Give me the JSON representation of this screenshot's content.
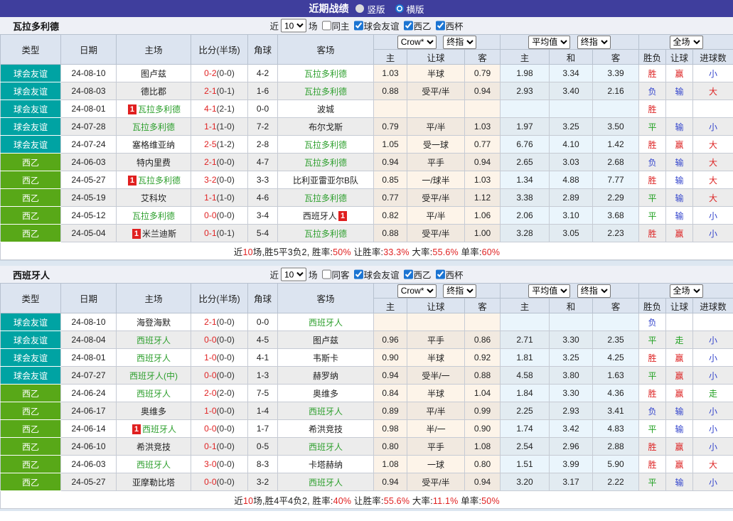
{
  "colors": {
    "titlebar_bg": "#3f3e9d",
    "type_friendly": "#00a3a3",
    "type_league": "#58a818",
    "team_green": "#2fa02f",
    "score_red": "#e02222",
    "red": "#dd2222",
    "blue": "#3344cc",
    "green": "#1fa01f",
    "badge_bg": "#e02020",
    "accent_blue": "#1b74d2"
  },
  "titlebar": {
    "title": "近期战绩",
    "radios": [
      {
        "label": "竖版",
        "selected": false
      },
      {
        "label": "横版",
        "selected": true
      }
    ]
  },
  "controls": {
    "near": "近",
    "games": "场",
    "count": "10",
    "book": "Crow*",
    "final": "终指",
    "average": "平均值",
    "scope": "全场"
  },
  "header": {
    "cols": [
      "类型",
      "日期",
      "主场",
      "比分(半场)",
      "角球",
      "客场"
    ],
    "subcols": [
      "主",
      "让球",
      "客",
      "主",
      "和",
      "客",
      "胜负",
      "让球",
      "进球数"
    ]
  },
  "tables": [
    {
      "team": "瓦拉多利德",
      "filter": {
        "same_label": "同主",
        "same_checked": false,
        "comps": [
          {
            "label": "球会友谊",
            "checked": true
          },
          {
            "label": "西乙",
            "checked": true
          },
          {
            "label": "西杯",
            "checked": true
          }
        ]
      },
      "rows": [
        {
          "type": "球会友谊",
          "type_key": "friendly",
          "date": "24-08-10",
          "home": {
            "name": "图卢兹",
            "green": false
          },
          "ft": "0-2",
          "ht": "(0-0)",
          "corner": "4-2",
          "away": {
            "name": "瓦拉多利德",
            "green": true
          },
          "odds": [
            "1.03",
            "半球",
            "0.79",
            "1.98",
            "3.34",
            "3.39"
          ],
          "results": [
            {
              "t": "胜",
              "c": "red"
            },
            {
              "t": "赢",
              "c": "red"
            },
            {
              "t": "小",
              "c": "blue"
            }
          ]
        },
        {
          "type": "球会友谊",
          "type_key": "friendly",
          "date": "24-08-03",
          "home": {
            "name": "德比郡",
            "green": false
          },
          "ft": "2-1",
          "ht": "(0-1)",
          "corner": "1-6",
          "away": {
            "name": "瓦拉多利德",
            "green": true
          },
          "odds": [
            "0.88",
            "受平/半",
            "0.94",
            "2.93",
            "3.40",
            "2.16"
          ],
          "results": [
            {
              "t": "负",
              "c": "blue"
            },
            {
              "t": "输",
              "c": "blue"
            },
            {
              "t": "大",
              "c": "red"
            }
          ]
        },
        {
          "type": "球会友谊",
          "type_key": "friendly",
          "date": "24-08-01",
          "home": {
            "name": "瓦拉多利德",
            "green": true,
            "badge": "1",
            "badge_pos": "pre"
          },
          "ft": "4-1",
          "ht": "(2-1)",
          "corner": "0-0",
          "away": {
            "name": "波城",
            "green": false
          },
          "odds": [
            "",
            "",
            "",
            "",
            "",
            ""
          ],
          "results": [
            {
              "t": "胜",
              "c": "red"
            },
            {
              "t": "",
              "c": ""
            },
            {
              "t": "",
              "c": ""
            }
          ]
        },
        {
          "type": "球会友谊",
          "type_key": "friendly",
          "date": "24-07-28",
          "home": {
            "name": "瓦拉多利德",
            "green": true
          },
          "ft": "1-1",
          "ht": "(1-0)",
          "corner": "7-2",
          "away": {
            "name": "布尔戈斯",
            "green": false
          },
          "odds": [
            "0.79",
            "平/半",
            "1.03",
            "1.97",
            "3.25",
            "3.50"
          ],
          "results": [
            {
              "t": "平",
              "c": "green"
            },
            {
              "t": "输",
              "c": "blue"
            },
            {
              "t": "小",
              "c": "blue"
            }
          ]
        },
        {
          "type": "球会友谊",
          "type_key": "friendly",
          "date": "24-07-24",
          "home": {
            "name": "塞格维亚纳",
            "green": false
          },
          "ft": "2-5",
          "ht": "(1-2)",
          "corner": "2-8",
          "away": {
            "name": "瓦拉多利德",
            "green": true
          },
          "odds": [
            "1.05",
            "受一球",
            "0.77",
            "6.76",
            "4.10",
            "1.42"
          ],
          "results": [
            {
              "t": "胜",
              "c": "red"
            },
            {
              "t": "赢",
              "c": "red"
            },
            {
              "t": "大",
              "c": "red"
            }
          ]
        },
        {
          "type": "西乙",
          "type_key": "league",
          "date": "24-06-03",
          "home": {
            "name": "特内里费",
            "green": false
          },
          "ft": "2-1",
          "ht": "(0-0)",
          "corner": "4-7",
          "away": {
            "name": "瓦拉多利德",
            "green": true
          },
          "odds": [
            "0.94",
            "平手",
            "0.94",
            "2.65",
            "3.03",
            "2.68"
          ],
          "results": [
            {
              "t": "负",
              "c": "blue"
            },
            {
              "t": "输",
              "c": "blue"
            },
            {
              "t": "大",
              "c": "red"
            }
          ]
        },
        {
          "type": "西乙",
          "type_key": "league",
          "date": "24-05-27",
          "home": {
            "name": "瓦拉多利德",
            "green": true,
            "badge": "1",
            "badge_pos": "pre"
          },
          "ft": "3-2",
          "ht": "(0-0)",
          "corner": "3-3",
          "away": {
            "name": "比利亚雷亚尔B队",
            "green": false
          },
          "odds": [
            "0.85",
            "一/球半",
            "1.03",
            "1.34",
            "4.88",
            "7.77"
          ],
          "results": [
            {
              "t": "胜",
              "c": "red"
            },
            {
              "t": "输",
              "c": "blue"
            },
            {
              "t": "大",
              "c": "red"
            }
          ]
        },
        {
          "type": "西乙",
          "type_key": "league",
          "date": "24-05-19",
          "home": {
            "name": "艾科坎",
            "green": false
          },
          "ft": "1-1",
          "ht": "(1-0)",
          "corner": "4-6",
          "away": {
            "name": "瓦拉多利德",
            "green": true
          },
          "odds": [
            "0.77",
            "受平/半",
            "1.12",
            "3.38",
            "2.89",
            "2.29"
          ],
          "results": [
            {
              "t": "平",
              "c": "green"
            },
            {
              "t": "输",
              "c": "blue"
            },
            {
              "t": "大",
              "c": "red"
            }
          ]
        },
        {
          "type": "西乙",
          "type_key": "league",
          "date": "24-05-12",
          "home": {
            "name": "瓦拉多利德",
            "green": true
          },
          "ft": "0-0",
          "ht": "(0-0)",
          "corner": "3-4",
          "away": {
            "name": "西班牙人",
            "green": false,
            "badge": "1",
            "badge_pos": "post"
          },
          "odds": [
            "0.82",
            "平/半",
            "1.06",
            "2.06",
            "3.10",
            "3.68"
          ],
          "results": [
            {
              "t": "平",
              "c": "green"
            },
            {
              "t": "输",
              "c": "blue"
            },
            {
              "t": "小",
              "c": "blue"
            }
          ]
        },
        {
          "type": "西乙",
          "type_key": "league",
          "date": "24-05-04",
          "home": {
            "name": "米兰迪斯",
            "green": false,
            "badge": "1",
            "badge_pos": "pre"
          },
          "ft": "0-1",
          "ht": "(0-1)",
          "corner": "5-4",
          "away": {
            "name": "瓦拉多利德",
            "green": true
          },
          "odds": [
            "0.88",
            "受平/半",
            "1.00",
            "3.28",
            "3.05",
            "2.23"
          ],
          "results": [
            {
              "t": "胜",
              "c": "red"
            },
            {
              "t": "赢",
              "c": "red"
            },
            {
              "t": "小",
              "c": "blue"
            }
          ]
        }
      ],
      "summary": [
        [
          "近",
          "k"
        ],
        [
          "10",
          "r"
        ],
        [
          "场,胜5平3负2, 胜率:",
          "k"
        ],
        [
          "50%",
          "r"
        ],
        [
          " 让胜率:",
          "k"
        ],
        [
          "33.3%",
          "r"
        ],
        [
          " 大率:",
          "k"
        ],
        [
          "55.6%",
          "r"
        ],
        [
          " 单率:",
          "k"
        ],
        [
          "60%",
          "r"
        ]
      ]
    },
    {
      "team": "西班牙人",
      "filter": {
        "same_label": "同客",
        "same_checked": false,
        "comps": [
          {
            "label": "球会友谊",
            "checked": true
          },
          {
            "label": "西乙",
            "checked": true
          },
          {
            "label": "西杯",
            "checked": true
          }
        ]
      },
      "rows": [
        {
          "type": "球会友谊",
          "type_key": "friendly",
          "date": "24-08-10",
          "home": {
            "name": "海登海默",
            "green": false
          },
          "ft": "2-1",
          "ht": "(0-0)",
          "corner": "0-0",
          "away": {
            "name": "西班牙人",
            "green": true
          },
          "odds": [
            "",
            "",
            "",
            "",
            "",
            ""
          ],
          "results": [
            {
              "t": "负",
              "c": "blue"
            },
            {
              "t": "",
              "c": ""
            },
            {
              "t": "",
              "c": ""
            }
          ]
        },
        {
          "type": "球会友谊",
          "type_key": "friendly",
          "date": "24-08-04",
          "home": {
            "name": "西班牙人",
            "green": true
          },
          "ft": "0-0",
          "ht": "(0-0)",
          "corner": "4-5",
          "away": {
            "name": "图卢兹",
            "green": false
          },
          "odds": [
            "0.96",
            "平手",
            "0.86",
            "2.71",
            "3.30",
            "2.35"
          ],
          "results": [
            {
              "t": "平",
              "c": "green"
            },
            {
              "t": "走",
              "c": "green"
            },
            {
              "t": "小",
              "c": "blue"
            }
          ]
        },
        {
          "type": "球会友谊",
          "type_key": "friendly",
          "date": "24-08-01",
          "home": {
            "name": "西班牙人",
            "green": true
          },
          "ft": "1-0",
          "ht": "(0-0)",
          "corner": "4-1",
          "away": {
            "name": "韦斯卡",
            "green": false
          },
          "odds": [
            "0.90",
            "半球",
            "0.92",
            "1.81",
            "3.25",
            "4.25"
          ],
          "results": [
            {
              "t": "胜",
              "c": "red"
            },
            {
              "t": "赢",
              "c": "red"
            },
            {
              "t": "小",
              "c": "blue"
            }
          ]
        },
        {
          "type": "球会友谊",
          "type_key": "friendly",
          "date": "24-07-27",
          "home": {
            "name": "西班牙人(中)",
            "green": true
          },
          "ft": "0-0",
          "ht": "(0-0)",
          "corner": "1-3",
          "away": {
            "name": "赫罗纳",
            "green": false
          },
          "odds": [
            "0.94",
            "受半/一",
            "0.88",
            "4.58",
            "3.80",
            "1.63"
          ],
          "results": [
            {
              "t": "平",
              "c": "green"
            },
            {
              "t": "赢",
              "c": "red"
            },
            {
              "t": "小",
              "c": "blue"
            }
          ]
        },
        {
          "type": "西乙",
          "type_key": "league",
          "date": "24-06-24",
          "home": {
            "name": "西班牙人",
            "green": true
          },
          "ft": "2-0",
          "ht": "(2-0)",
          "corner": "7-5",
          "away": {
            "name": "奥维多",
            "green": false
          },
          "odds": [
            "0.84",
            "半球",
            "1.04",
            "1.84",
            "3.30",
            "4.36"
          ],
          "results": [
            {
              "t": "胜",
              "c": "red"
            },
            {
              "t": "赢",
              "c": "red"
            },
            {
              "t": "走",
              "c": "green"
            }
          ]
        },
        {
          "type": "西乙",
          "type_key": "league",
          "date": "24-06-17",
          "home": {
            "name": "奥维多",
            "green": false
          },
          "ft": "1-0",
          "ht": "(0-0)",
          "corner": "1-4",
          "away": {
            "name": "西班牙人",
            "green": true
          },
          "odds": [
            "0.89",
            "平/半",
            "0.99",
            "2.25",
            "2.93",
            "3.41"
          ],
          "results": [
            {
              "t": "负",
              "c": "blue"
            },
            {
              "t": "输",
              "c": "blue"
            },
            {
              "t": "小",
              "c": "blue"
            }
          ]
        },
        {
          "type": "西乙",
          "type_key": "league",
          "date": "24-06-14",
          "home": {
            "name": "西班牙人",
            "green": true,
            "badge": "1",
            "badge_pos": "pre"
          },
          "ft": "0-0",
          "ht": "(0-0)",
          "corner": "1-7",
          "away": {
            "name": "希洪竞技",
            "green": false
          },
          "odds": [
            "0.98",
            "半/一",
            "0.90",
            "1.74",
            "3.42",
            "4.83"
          ],
          "results": [
            {
              "t": "平",
              "c": "green"
            },
            {
              "t": "输",
              "c": "blue"
            },
            {
              "t": "小",
              "c": "blue"
            }
          ]
        },
        {
          "type": "西乙",
          "type_key": "league",
          "date": "24-06-10",
          "home": {
            "name": "希洪竞技",
            "green": false
          },
          "ft": "0-1",
          "ht": "(0-0)",
          "corner": "0-5",
          "away": {
            "name": "西班牙人",
            "green": true
          },
          "odds": [
            "0.80",
            "平手",
            "1.08",
            "2.54",
            "2.96",
            "2.88"
          ],
          "results": [
            {
              "t": "胜",
              "c": "red"
            },
            {
              "t": "赢",
              "c": "red"
            },
            {
              "t": "小",
              "c": "blue"
            }
          ]
        },
        {
          "type": "西乙",
          "type_key": "league",
          "date": "24-06-03",
          "home": {
            "name": "西班牙人",
            "green": true
          },
          "ft": "3-0",
          "ht": "(0-0)",
          "corner": "8-3",
          "away": {
            "name": "卡塔赫纳",
            "green": false
          },
          "odds": [
            "1.08",
            "一球",
            "0.80",
            "1.51",
            "3.99",
            "5.90"
          ],
          "results": [
            {
              "t": "胜",
              "c": "red"
            },
            {
              "t": "赢",
              "c": "red"
            },
            {
              "t": "大",
              "c": "red"
            }
          ]
        },
        {
          "type": "西乙",
          "type_key": "league",
          "date": "24-05-27",
          "home": {
            "name": "亚摩勒比塔",
            "green": false
          },
          "ft": "0-0",
          "ht": "(0-0)",
          "corner": "3-2",
          "away": {
            "name": "西班牙人",
            "green": true
          },
          "odds": [
            "0.94",
            "受平/半",
            "0.94",
            "3.20",
            "3.17",
            "2.22"
          ],
          "results": [
            {
              "t": "平",
              "c": "green"
            },
            {
              "t": "输",
              "c": "blue"
            },
            {
              "t": "小",
              "c": "blue"
            }
          ]
        }
      ],
      "summary": [
        [
          "近",
          "k"
        ],
        [
          "10",
          "r"
        ],
        [
          "场,胜4平4负2, 胜率:",
          "k"
        ],
        [
          "40%",
          "r"
        ],
        [
          " 让胜率:",
          "k"
        ],
        [
          "55.6%",
          "r"
        ],
        [
          " 大率:",
          "k"
        ],
        [
          "11.1%",
          "r"
        ],
        [
          " 单率:",
          "k"
        ],
        [
          "50%",
          "r"
        ]
      ]
    }
  ]
}
